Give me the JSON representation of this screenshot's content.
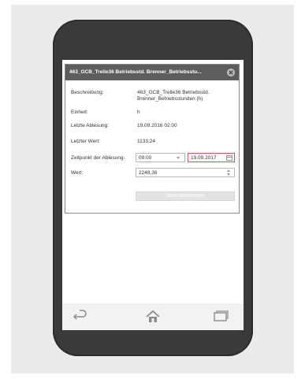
{
  "dialog": {
    "title": "463_GCB_Trelle36 Betriebsstd. Brenner_Betriebsstu...",
    "fields": {
      "beschreibung_label": "Beschreibung:",
      "beschreibung_value_line1": "463_GCB_Trelle36 Betriebsstd.",
      "beschreibung_value_line2": "Brenner_Betriebsstunden (h)",
      "einheit_label": "Einheit:",
      "einheit_value": "h",
      "letzte_ablesung_label": "Letzte Ablesung:",
      "letzte_ablesung_value": "19.09.2016 02:00",
      "letzter_wert_label": "Letzter Wert:",
      "letzter_wert_value": "1133,24",
      "zeitpunkt_label": "Zeitpunkt der Ablesung:",
      "zeitpunkt_time": "09:00",
      "zeitpunkt_date": "19.09.2017",
      "wert_label": "Wert:",
      "wert_value": "2248,36"
    },
    "submit_label": "Wert übernehmen"
  },
  "nav": {
    "back_icon": "back-icon",
    "home_icon": "home-icon",
    "recent_icon": "recent-apps-icon"
  },
  "colors": {
    "header": "#5d5d5d",
    "date_border": "#d05a4f",
    "phone_body": "#3a3a3a"
  }
}
